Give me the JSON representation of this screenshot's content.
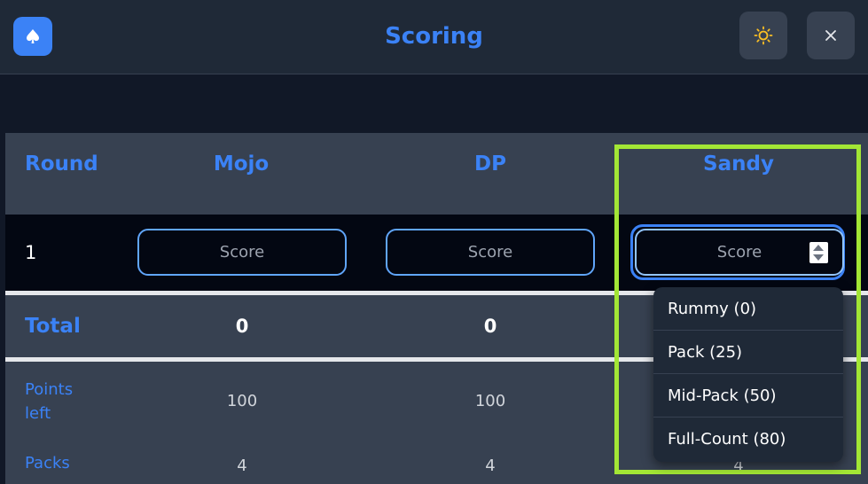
{
  "header": {
    "title": "Scoring",
    "logo_icon": "spade-icon",
    "theme_icon": "sun-icon",
    "close_icon": "close-icon"
  },
  "table": {
    "headers": [
      "Round",
      "Mojo",
      "DP",
      "Sandy"
    ],
    "rounds": [
      {
        "number": "1",
        "placeholders": [
          "Score",
          "Score",
          "Score"
        ]
      }
    ],
    "total": {
      "label": "Total",
      "values": [
        "0",
        "0"
      ]
    },
    "points_left": {
      "label": "Points left",
      "values": [
        "100",
        "100"
      ]
    },
    "packs": {
      "label": "Packs",
      "values": [
        "4",
        "4",
        "4"
      ]
    }
  },
  "dropdown": {
    "options": [
      "Rummy (0)",
      "Pack (25)",
      "Mid-Pack (50)",
      "Full-Count (80)"
    ]
  },
  "colors": {
    "accent": "#3b82f6",
    "highlight": "#a3e635",
    "background": "#111827"
  }
}
